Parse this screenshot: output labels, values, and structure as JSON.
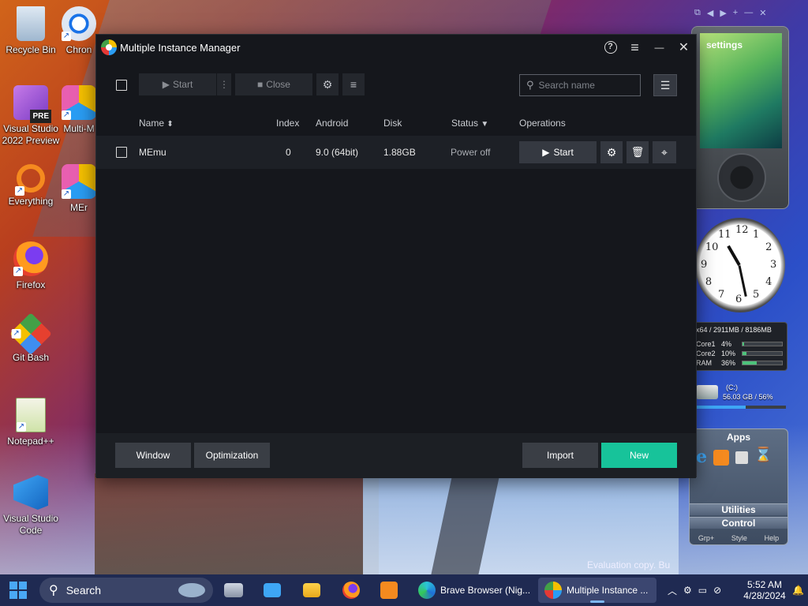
{
  "window": {
    "title": "Multiple Instance Manager",
    "help_label": "?",
    "menu_label": "≡",
    "minimize_label": "—",
    "close_label": "✕"
  },
  "toolbar": {
    "start_label": "Start",
    "close_label": "Close",
    "more_label": "⋮",
    "gear_label": "⚙",
    "list_label": "≡",
    "search_placeholder": "Search name"
  },
  "table": {
    "columns": [
      "Name",
      "Index",
      "Android",
      "Disk",
      "Status",
      "Operations"
    ],
    "sort_indicator": "⬍",
    "filter_indicator": "▼",
    "rows": [
      {
        "name": "MEmu",
        "index": "0",
        "android": "9.0 (64bit)",
        "disk": "1.88GB",
        "status": "Power off",
        "start_label": "Start"
      }
    ]
  },
  "bottom": {
    "window_label": "Window",
    "optimization_label": "Optimization",
    "import_label": "Import",
    "new_label": "New"
  },
  "desktop": {
    "icons": [
      {
        "label": "Recycle Bin"
      },
      {
        "label": "Chron"
      },
      {
        "label": "Visual Studio 2022 Preview",
        "badge": "PRE"
      },
      {
        "label": "Multi-M"
      },
      {
        "label": "Everything"
      },
      {
        "label": "MEr"
      },
      {
        "label": "Firefox"
      },
      {
        "label": "Git Bash"
      },
      {
        "label": "Notepad++"
      },
      {
        "label": "Visual Studio Code"
      }
    ],
    "evaluation_text": "Evaluation copy. Bu"
  },
  "gadgets": {
    "zune_label": "settings",
    "cpu_header": "x64 / 2911MB / 8186MB",
    "cpu_rows": [
      {
        "label": "Core1",
        "value": "4%",
        "fill": 0.04
      },
      {
        "label": "Core2",
        "value": "10%",
        "fill": 0.1
      },
      {
        "label": "RAM",
        "value": "36%",
        "fill": 0.36
      }
    ],
    "drive_label": "(C:)",
    "drive_info": "56.03 GB / 56%",
    "apps_title": "Apps",
    "apps_utilities": "Utilities",
    "apps_control": "Control",
    "apps_footer": [
      "Grp+",
      "Style",
      "Help"
    ],
    "clock_numbers": [
      "12",
      "1",
      "2",
      "3",
      "4",
      "5",
      "6",
      "7",
      "8",
      "9",
      "10",
      "11"
    ]
  },
  "taskbar": {
    "search_label": "Search",
    "brave_label": "Brave Browser (Nig...",
    "mim_label": "Multiple Instance ...",
    "time": "5:52 AM",
    "date": "4/28/2024"
  }
}
